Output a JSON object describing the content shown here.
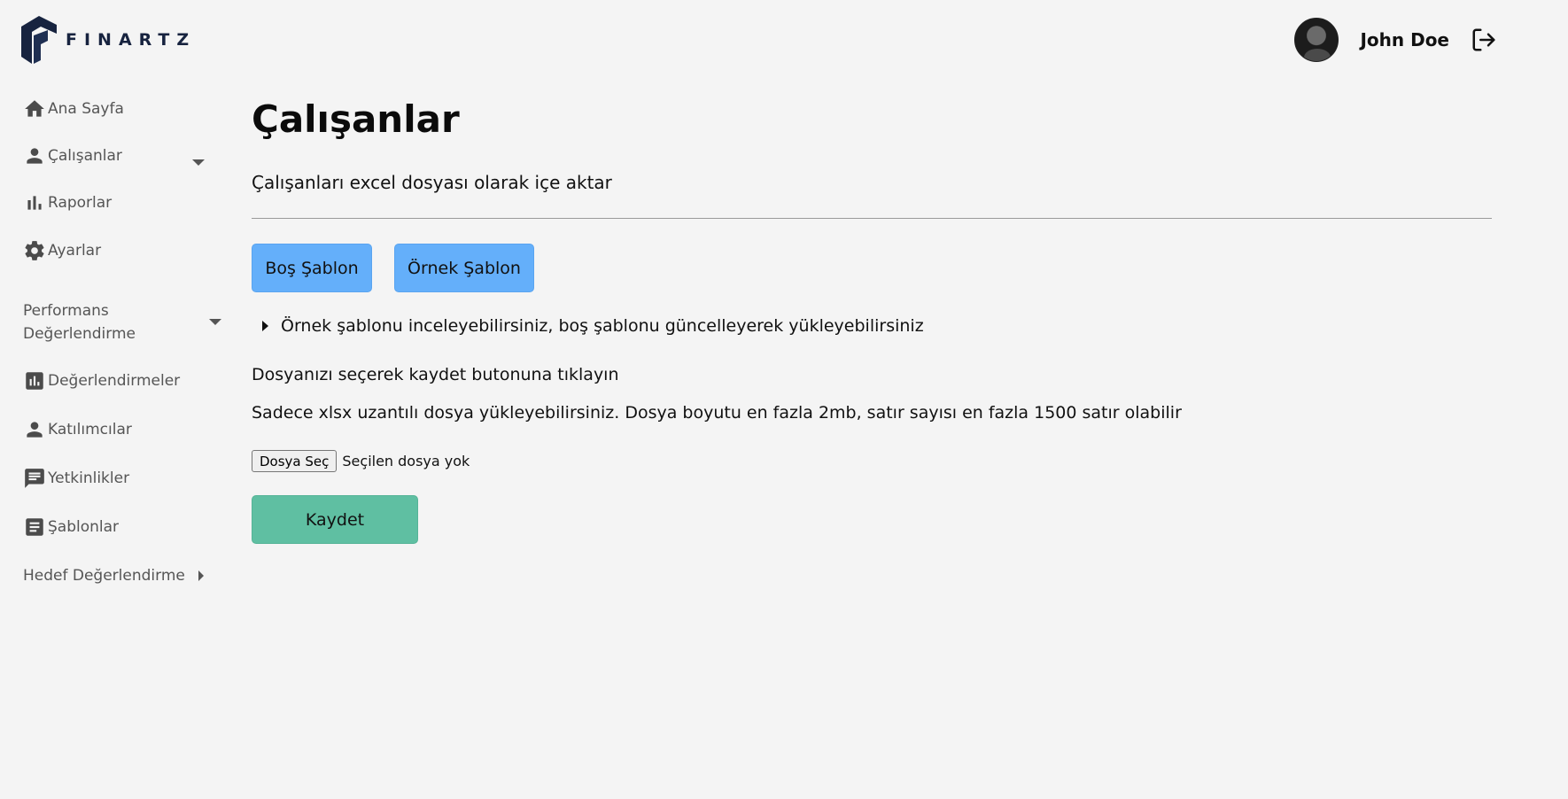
{
  "header": {
    "logo_text": "FINARTZ",
    "user_name": "John Doe"
  },
  "sidebar": {
    "items": [
      {
        "label": "Ana Sayfa",
        "icon": "home-icon"
      },
      {
        "label": "Çalışanlar",
        "icon": "person-icon"
      },
      {
        "label": "Raporlar",
        "icon": "bar-chart-icon"
      },
      {
        "label": "Ayarlar",
        "icon": "gear-icon"
      }
    ],
    "performance_group": {
      "label_line1": "Performans",
      "label_line2": "Değerlendirme",
      "items": [
        {
          "label": "Değerlendirmeler",
          "icon": "assessment-icon"
        },
        {
          "label": "Katılımcılar",
          "icon": "person-icon"
        },
        {
          "label": "Yetkinlikler",
          "icon": "comment-icon"
        },
        {
          "label": "Şablonlar",
          "icon": "template-icon"
        }
      ]
    },
    "target_group": {
      "label": "Hedef Değerlendirme"
    }
  },
  "main": {
    "title": "Çalışanlar",
    "subtitle": "Çalışanları excel dosyası olarak içe aktar",
    "empty_template_button": "Boş Şablon",
    "sample_template_button": "Örnek Şablon",
    "details_summary": "Örnek şablonu inceleyebilirsiniz, boş şablonu güncelleyerek yükleyebilirsiniz",
    "instruction": "Dosyanızı seçerek kaydet butonuna tıklayın",
    "restriction": "Sadece xlsx uzantılı dosya yükleyebilirsiniz. Dosya boyutu en fazla 2mb, satır sayısı en fazla 1500 satır olabilir",
    "file_button": "Dosya Seç",
    "file_status": "Seçilen dosya yok",
    "save_button": "Kaydet"
  },
  "colors": {
    "background": "#f4f4f4",
    "template_button": "#64affa",
    "save_button": "#5fbfa2",
    "logo": "#17233f"
  }
}
